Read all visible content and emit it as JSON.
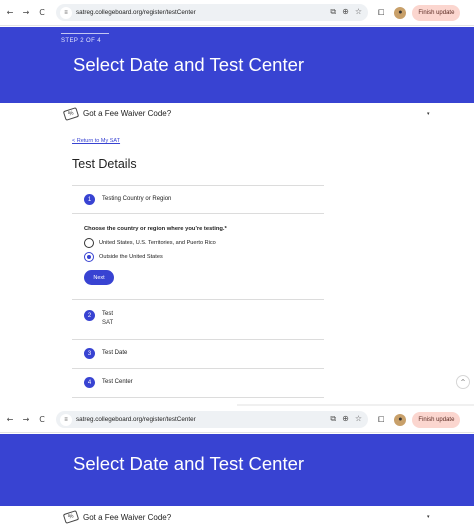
{
  "browser": {
    "url": "satreg.collegeboard.org/register/testCenter",
    "back_icon": "←",
    "forward_icon": "→",
    "reload_icon": "C",
    "tune_icon": "≡",
    "cast_icon": "⧉",
    "zoom_icon": "⊕",
    "star_icon": "☆",
    "extensions_icon": "⧠",
    "profile_icon": "●",
    "finish_update_label": "Finish update",
    "menu_icon": "⋮"
  },
  "hero": {
    "step_text": "STEP 2 OF 4",
    "title": "Select Date and Test Center"
  },
  "fee_waiver": {
    "label": "Got a Fee Waiver Code?",
    "icon_glyph": "%",
    "chevron": "▾"
  },
  "main": {
    "return_link": "< Return to My SAT",
    "section_title": "Test Details",
    "steps": [
      {
        "number": "1",
        "label": "Testing Country or Region"
      },
      {
        "number": "2",
        "label": "Test",
        "sub": "SAT"
      },
      {
        "number": "3",
        "label": "Test Date"
      },
      {
        "number": "4",
        "label": "Test Center"
      }
    ],
    "country_question": "Choose the country or region where you're testing.*",
    "options": [
      {
        "label": "United States, U.S. Territories, and Puerto Rico",
        "selected": false
      },
      {
        "label": "Outside the United States",
        "selected": true
      }
    ],
    "next_label": "Next",
    "scroll_top_icon": "^"
  },
  "colors": {
    "brand_blue": "#3843d2",
    "finish_update_bg": "#fbd6cf"
  }
}
